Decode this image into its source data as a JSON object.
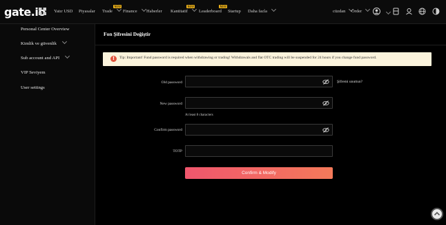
{
  "header": {
    "logo": "gate.io",
    "nav": [
      {
        "label": "Yatır USD"
      },
      {
        "label": "Piyasalar"
      },
      {
        "label": "Trade",
        "badge": "NEW"
      },
      {
        "label": "Finance"
      },
      {
        "label": "Haberler"
      },
      {
        "label": "Kantitatif",
        "badge": "NEW"
      },
      {
        "label": "Leaderboard",
        "badge": "NEW"
      },
      {
        "label": "Startup"
      },
      {
        "label": "Daha fazla"
      }
    ],
    "right": {
      "funds": "cüzdan",
      "orders": "Order"
    }
  },
  "sidebar": {
    "items": [
      {
        "label": "Personal Center Overview"
      },
      {
        "label": "Kimlik ve güvenlik"
      },
      {
        "label": "Sub account and API"
      },
      {
        "label": "VIP Seviyem"
      },
      {
        "label": "User settings"
      }
    ]
  },
  "main": {
    "title": "Fon Şifresini Değiştir",
    "tip": "Tip: Important! Fund password is required when withdrawing or trading! Withdrawals and flat OTC trading will be suspended for 24 hours if you change fund password.",
    "fields": {
      "old_password": {
        "label": "Old password",
        "value": ""
      },
      "forgot": "Şifremi unuttun?",
      "new_password": {
        "label": "New password",
        "value": "",
        "hint": "At least 8 characters"
      },
      "confirm_password": {
        "label": "Confirm password",
        "value": ""
      },
      "totp": {
        "label": "TOTP",
        "value": ""
      }
    },
    "confirm_button": "Confirm & Modify"
  },
  "colors": {
    "accent_start": "#f0566d",
    "accent_end": "#f47a5a",
    "tip_bg": "#fbf3dc",
    "badge": "#f1b51c"
  }
}
